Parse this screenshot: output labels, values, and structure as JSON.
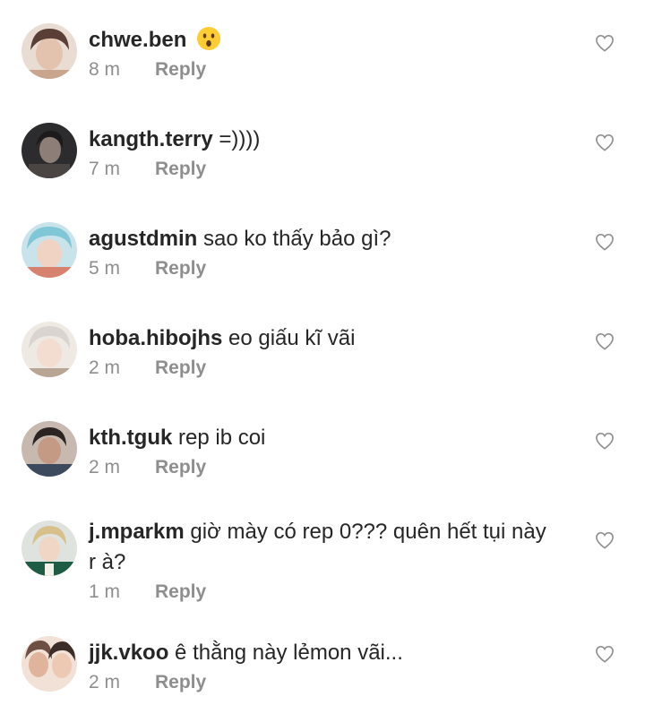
{
  "comments": [
    {
      "username": "chwe.ben",
      "text": "",
      "emoji": "hushed-face-emoji",
      "time": "8 m",
      "reply_label": "Reply",
      "like_icon": "heart-outline-icon",
      "avatar_colors": [
        "#c9a58e",
        "#5a3f36"
      ]
    },
    {
      "username": "kangth.terry",
      "text": "=))))",
      "time": "7 m",
      "reply_label": "Reply",
      "like_icon": "heart-outline-icon",
      "avatar_colors": [
        "#2c2c2e",
        "#8d7f77"
      ]
    },
    {
      "username": "agustdmin",
      "text": "sao ko thấy bảo gì?",
      "time": "5 m",
      "reply_label": "Reply",
      "like_icon": "heart-outline-icon",
      "avatar_colors": [
        "#7fc7d6",
        "#d7826e"
      ]
    },
    {
      "username": "hoba.hibojhs",
      "text": "eo giấu kĩ vãi",
      "time": "2 m",
      "reply_label": "Reply",
      "like_icon": "heart-outline-icon",
      "avatar_colors": [
        "#d9d4cf",
        "#b9a594"
      ]
    },
    {
      "username": "kth.tguk",
      "text": "rep ib coi",
      "time": "2 m",
      "reply_label": "Reply",
      "like_icon": "heart-outline-icon",
      "avatar_colors": [
        "#3d4a5e",
        "#c49a84"
      ]
    },
    {
      "username": "j.mparkm",
      "text": "giờ mày có rep 0??? quên hết tụi này r à?",
      "time": "1 m",
      "reply_label": "Reply",
      "like_icon": "heart-outline-icon",
      "avatar_colors": [
        "#1f5c45",
        "#d8c08a"
      ]
    },
    {
      "username": "jjk.vkoo",
      "text": "ê thằng này lẻmon vãi...",
      "time": "2 m",
      "reply_label": "Reply",
      "like_icon": "heart-outline-icon",
      "avatar_colors": [
        "#e0b49c",
        "#6d4f43"
      ]
    }
  ]
}
